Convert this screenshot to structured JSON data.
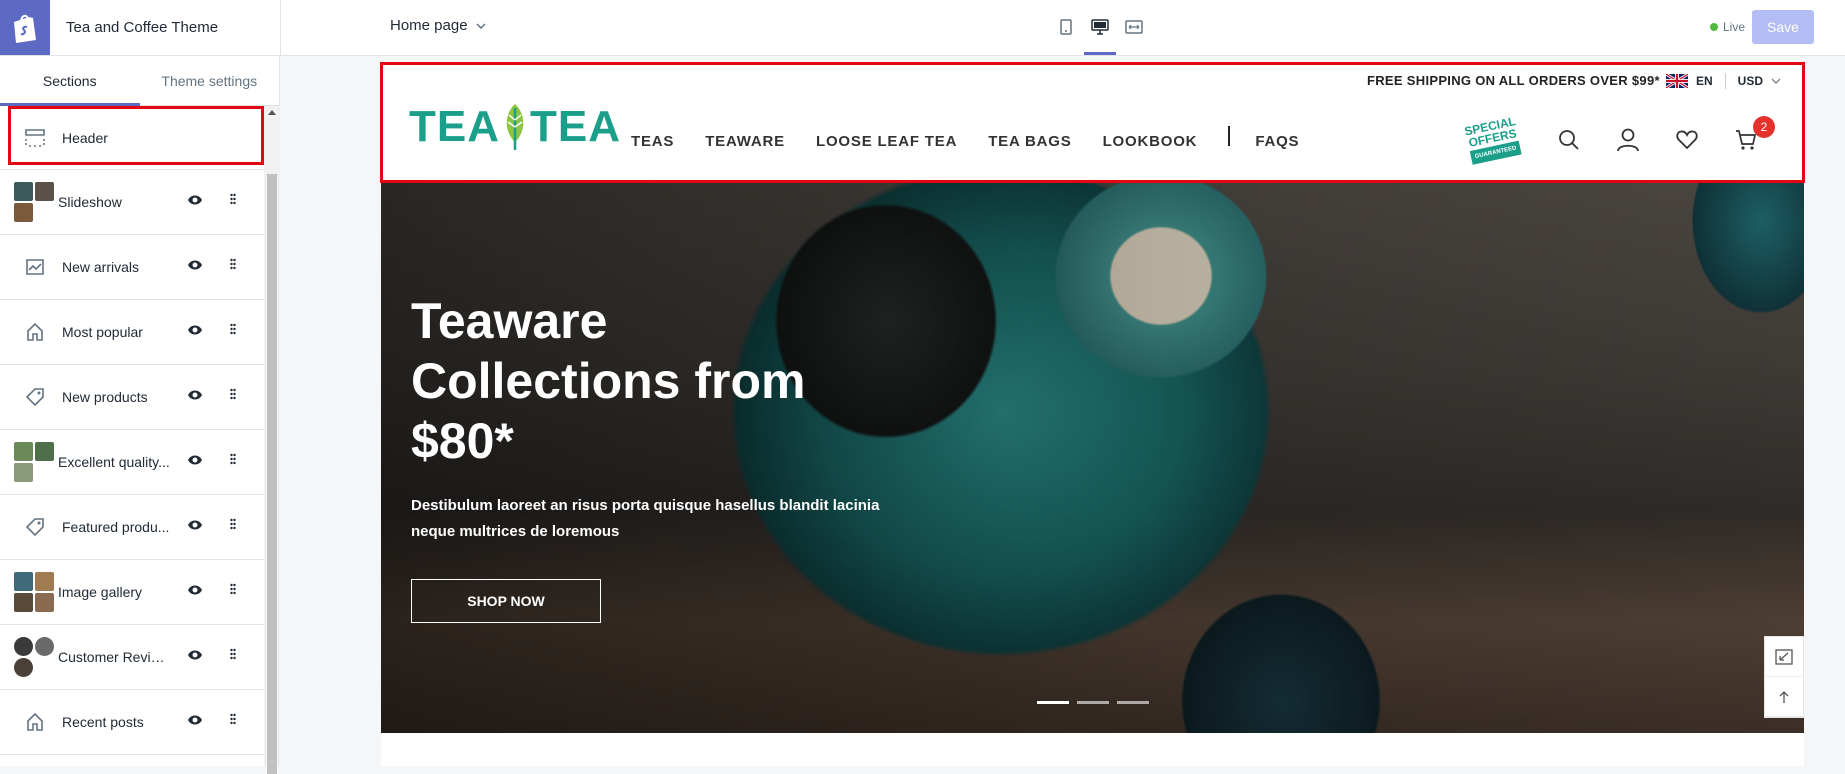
{
  "editor": {
    "theme_name": "Tea and Coffee Theme",
    "page_select": "Home page",
    "live_label": "Live",
    "save_label": "Save",
    "tabs": [
      "Sections",
      "Theme settings"
    ]
  },
  "sections": [
    {
      "label": "Header",
      "icon": "header-layout-icon"
    },
    {
      "label": "Slideshow",
      "icon": "image-thumbnails"
    },
    {
      "label": "New arrivals",
      "icon": "image-chart-icon"
    },
    {
      "label": "Most popular",
      "icon": "home-icon"
    },
    {
      "label": "New products",
      "icon": "tag-icon"
    },
    {
      "label": "Excellent quality...",
      "icon": "image-thumbnails"
    },
    {
      "label": "Featured produ...",
      "icon": "tag-icon"
    },
    {
      "label": "Image gallery",
      "icon": "image-thumbnails"
    },
    {
      "label": "Customer Revie...",
      "icon": "avatar-thumbnails"
    },
    {
      "label": "Recent posts",
      "icon": "home-icon"
    }
  ],
  "store": {
    "shipping_notice": "FREE SHIPPING ON ALL ORDERS OVER $99*",
    "language": "EN",
    "currency": "USD",
    "logo_left": "TEA",
    "logo_right": "TEA",
    "nav": [
      "TEAS",
      "TEAWARE",
      "LOOSE LEAF TEA",
      "TEA BAGS",
      "LOOKBOOK",
      "FAQS"
    ],
    "special_offers_line1": "SPECIAL",
    "special_offers_line2": "OFFERS",
    "special_offers_ribbon": "GUARANTEED",
    "cart_count": "2",
    "accent_color": "#1b9e8a"
  },
  "hero": {
    "title": "Teaware Collections from $80*",
    "subtitle": "Destibulum laoreet an risus porta quisque hasellus blandit lacinia neque multrices de loremous",
    "button": "SHOP NOW",
    "slide_count": 3,
    "active_slide": 1
  }
}
